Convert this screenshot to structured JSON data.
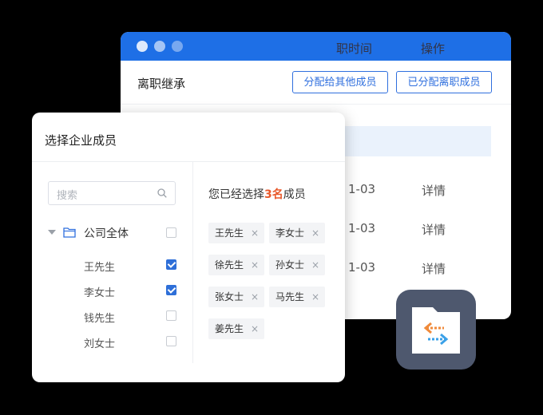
{
  "back_window": {
    "title": "离职继承",
    "btn_assign_other": "分配给其他成员",
    "btn_assigned": "已分配离职成员",
    "columns": [
      "职时间",
      "操作"
    ],
    "rows": [
      {
        "time": "1-03",
        "action": "详情"
      },
      {
        "time": "1-03",
        "action": "详情"
      },
      {
        "time": "1-03",
        "action": "详情"
      }
    ]
  },
  "dialog": {
    "title": "选择企业成员",
    "search_placeholder": "搜索",
    "root_label": "公司全体",
    "members": [
      {
        "name": "王先生",
        "checked": true
      },
      {
        "name": "李女士",
        "checked": true
      },
      {
        "name": "钱先生",
        "checked": false
      },
      {
        "name": "刘女士",
        "checked": false
      }
    ],
    "selected_prefix": "您已经选择",
    "selected_count": "3名",
    "selected_suffix": "成员",
    "tags": [
      "王先生",
      "李女士",
      "徐先生",
      "孙女士",
      "张女士",
      "马先生",
      "姜先生"
    ],
    "tag_close": "×"
  },
  "colors": {
    "titlebar": "#1e6fe6",
    "accent": "#2f6fde",
    "count": "#e8592b",
    "app_icon_bg": "#4e586e"
  },
  "icons": {
    "search": "search-icon",
    "folder": "folder-icon",
    "app": "folder-transfer-icon"
  }
}
